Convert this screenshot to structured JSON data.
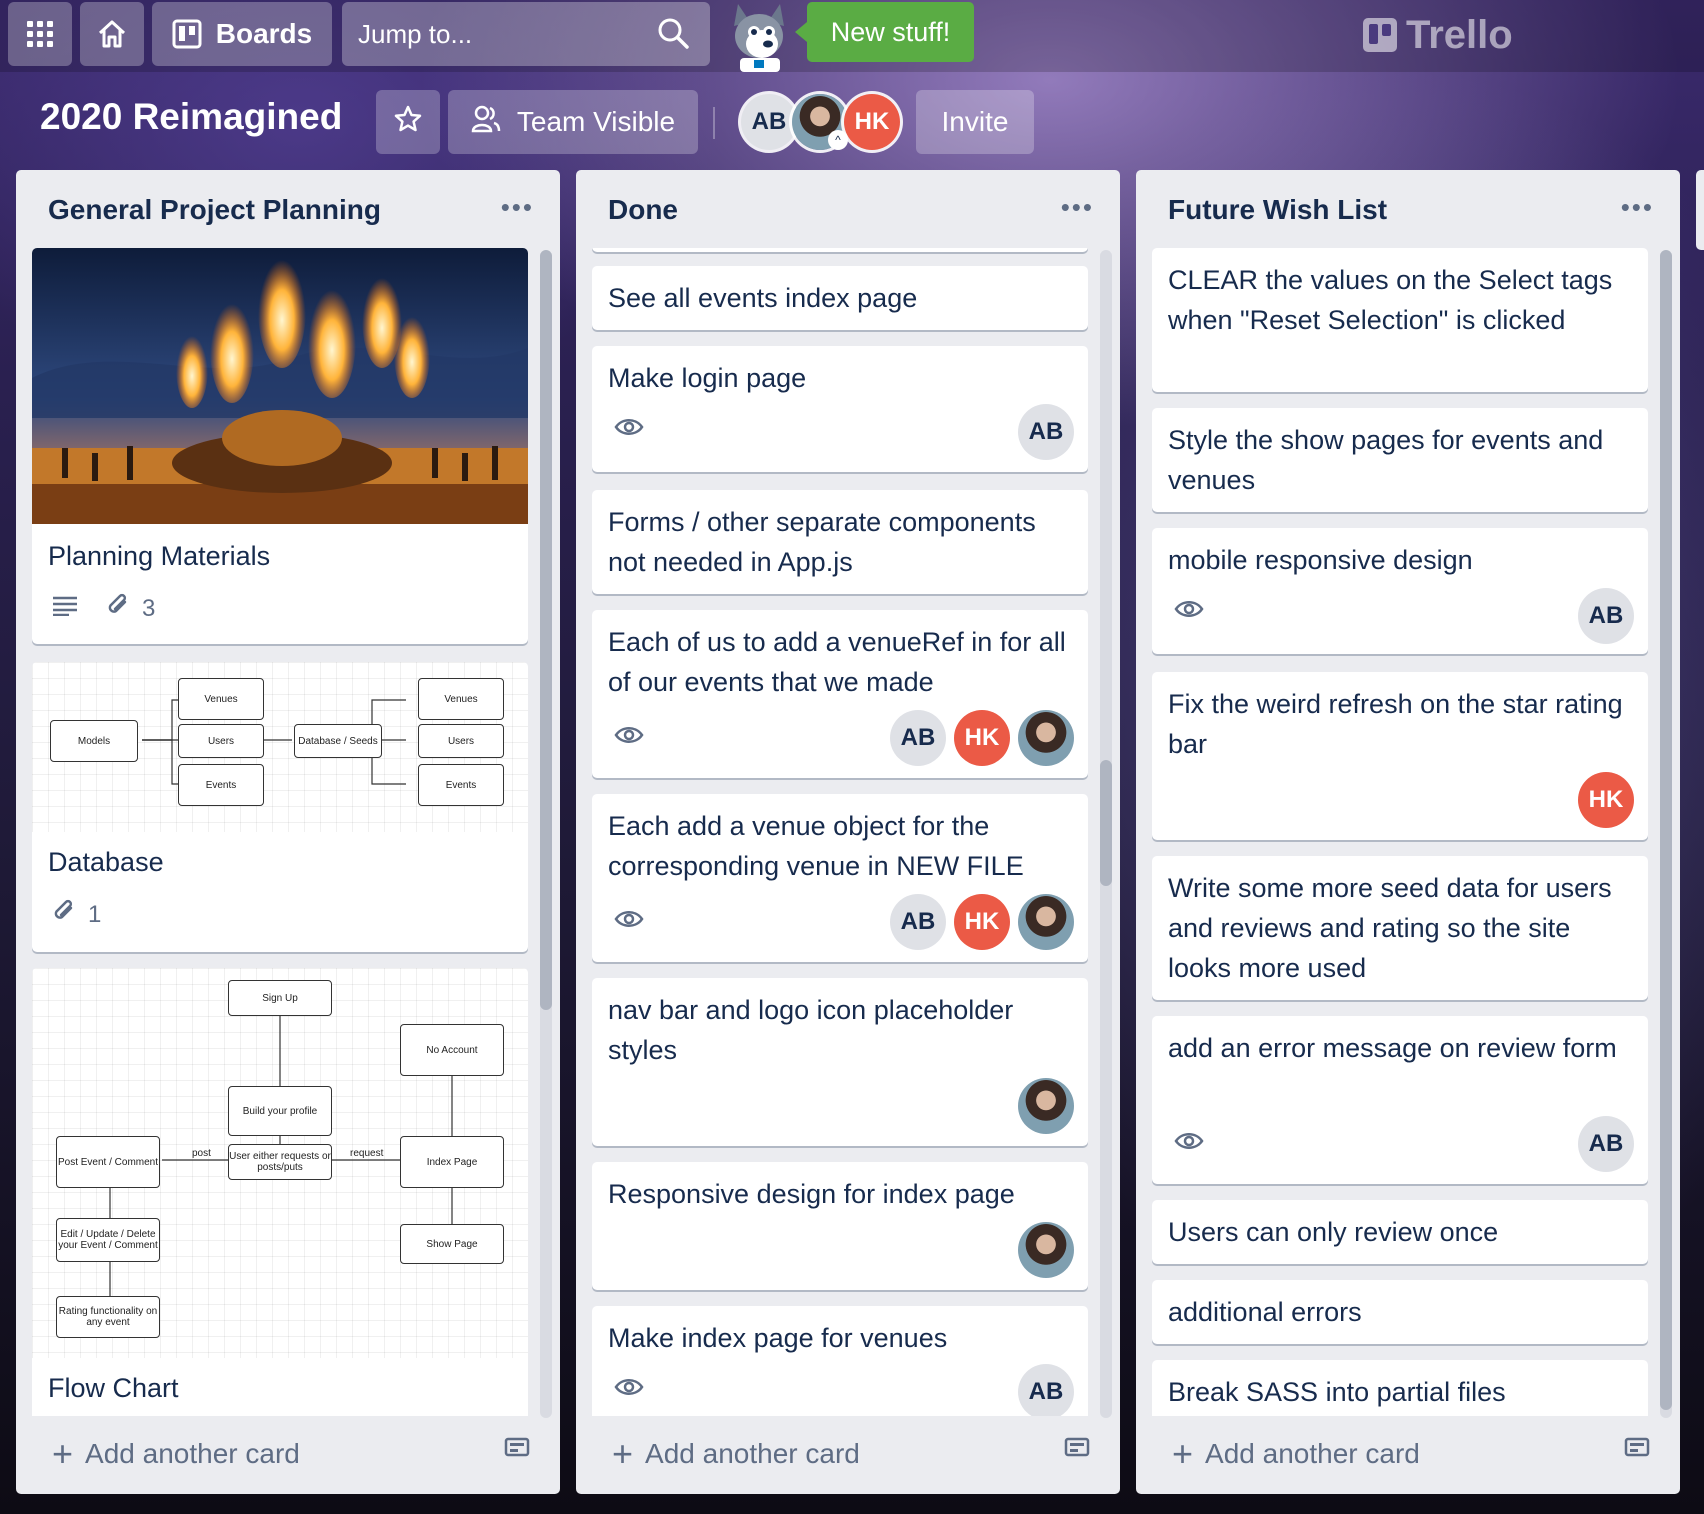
{
  "header": {
    "boards_label": "Boards",
    "search_placeholder": "Jump to...",
    "new_stuff": "New stuff!",
    "logo_text": "Trello"
  },
  "board": {
    "title": "2020 Reimagined",
    "visibility": "Team Visible",
    "invite": "Invite",
    "members": [
      "AB",
      "HK"
    ]
  },
  "lists": [
    {
      "title": "General Project Planning",
      "add_card": "Add another card",
      "cards": [
        {
          "title": "Planning Materials",
          "attachments": "3"
        },
        {
          "title": "Database",
          "attachments": "1",
          "diagram": {
            "models": "Models",
            "venues": "Venues",
            "users": "Users",
            "events": "Events",
            "db": "Database / Seeds"
          }
        },
        {
          "title": "Flow Chart",
          "diagram": {
            "signup": "Sign Up",
            "build": "Build your profile",
            "no_account": "No Account",
            "post_event": "Post Event / Comment",
            "user_req": "User either requests or posts/puts",
            "index": "Index Page",
            "edit": "Edit / Update / Delete your Event / Comment",
            "show": "Show Page",
            "rating": "Rating functionality on any event",
            "post": "post",
            "request": "request"
          }
        }
      ]
    },
    {
      "title": "Done",
      "add_card": "Add another card",
      "cards": [
        {
          "title": "See all events index page"
        },
        {
          "title": "Make login page",
          "members": [
            "AB"
          ]
        },
        {
          "title": "Forms / other separate components not needed in App.js"
        },
        {
          "title": "Each of us to add a venueRef in for all of our events that we made",
          "members": [
            "AB",
            "HK"
          ]
        },
        {
          "title": "Each add a venue object for the corresponding venue in NEW FILE",
          "members": [
            "AB",
            "HK"
          ]
        },
        {
          "title": "nav bar and logo icon placeholder styles"
        },
        {
          "title": "Responsive design for index page"
        },
        {
          "title": "Make index page for venues",
          "members": [
            "AB"
          ]
        }
      ]
    },
    {
      "title": "Future Wish List",
      "add_card": "Add another card",
      "cards": [
        {
          "title": "CLEAR the values on the Select tags when \"Reset Selection\" is clicked"
        },
        {
          "title": "Style the show pages for events and venues"
        },
        {
          "title": "mobile responsive design",
          "members": [
            "AB"
          ]
        },
        {
          "title": "Fix the weird refresh on the star rating bar",
          "members": [
            "HK"
          ]
        },
        {
          "title": "Write some more seed data for users and reviews and rating so the site looks more used"
        },
        {
          "title": "add an error message on review form",
          "members": [
            "AB"
          ]
        },
        {
          "title": "Users can only review once"
        },
        {
          "title": "additional errors"
        },
        {
          "title": "Break SASS into partial files"
        }
      ]
    }
  ],
  "colors": {
    "accent_green": "#5aac44",
    "hk_red": "#eb5a46",
    "list_bg": "#ebecf0"
  },
  "icons": [
    "apps-grid-icon",
    "home-icon",
    "boards-icon",
    "search-icon",
    "star-icon",
    "team-icon",
    "eye-icon",
    "attachment-icon",
    "description-icon",
    "card-template-icon",
    "plus-icon",
    "more-icon"
  ]
}
